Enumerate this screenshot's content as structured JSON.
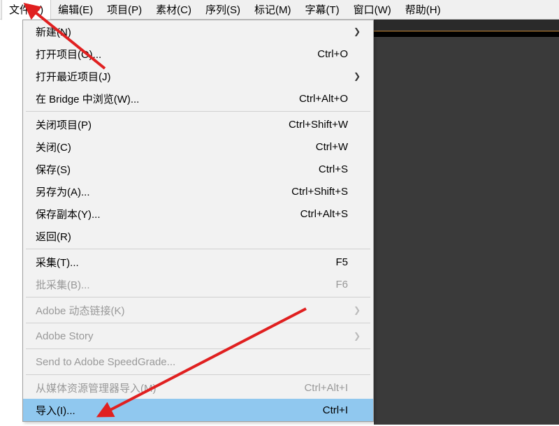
{
  "menubar": {
    "items": [
      {
        "label": "文件(F)"
      },
      {
        "label": "编辑(E)"
      },
      {
        "label": "项目(P)"
      },
      {
        "label": "素材(C)"
      },
      {
        "label": "序列(S)"
      },
      {
        "label": "标记(M)"
      },
      {
        "label": "字幕(T)"
      },
      {
        "label": "窗口(W)"
      },
      {
        "label": "帮助(H)"
      }
    ]
  },
  "dropdown": {
    "groups": [
      [
        {
          "label": "新建(N)",
          "shortcut": "",
          "arrow": true,
          "disabled": false
        },
        {
          "label": "打开项目(O)...",
          "shortcut": "Ctrl+O",
          "arrow": false,
          "disabled": false
        },
        {
          "label": "打开最近项目(J)",
          "shortcut": "",
          "arrow": true,
          "disabled": false
        },
        {
          "label": "在 Bridge 中浏览(W)...",
          "shortcut": "Ctrl+Alt+O",
          "arrow": false,
          "disabled": false
        }
      ],
      [
        {
          "label": "关闭项目(P)",
          "shortcut": "Ctrl+Shift+W",
          "arrow": false,
          "disabled": false
        },
        {
          "label": "关闭(C)",
          "shortcut": "Ctrl+W",
          "arrow": false,
          "disabled": false
        },
        {
          "label": "保存(S)",
          "shortcut": "Ctrl+S",
          "arrow": false,
          "disabled": false
        },
        {
          "label": "另存为(A)...",
          "shortcut": "Ctrl+Shift+S",
          "arrow": false,
          "disabled": false
        },
        {
          "label": "保存副本(Y)...",
          "shortcut": "Ctrl+Alt+S",
          "arrow": false,
          "disabled": false
        },
        {
          "label": "返回(R)",
          "shortcut": "",
          "arrow": false,
          "disabled": false
        }
      ],
      [
        {
          "label": "采集(T)...",
          "shortcut": "F5",
          "arrow": false,
          "disabled": false
        },
        {
          "label": "批采集(B)...",
          "shortcut": "F6",
          "arrow": false,
          "disabled": true
        }
      ],
      [
        {
          "label": "Adobe 动态链接(K)",
          "shortcut": "",
          "arrow": true,
          "disabled": true
        }
      ],
      [
        {
          "label": "Adobe Story",
          "shortcut": "",
          "arrow": true,
          "disabled": true
        }
      ],
      [
        {
          "label": "Send to Adobe SpeedGrade...",
          "shortcut": "",
          "arrow": false,
          "disabled": true
        }
      ],
      [
        {
          "label": "从媒体资源管理器导入(M)",
          "shortcut": "Ctrl+Alt+I",
          "arrow": false,
          "disabled": true
        },
        {
          "label": "导入(I)...",
          "shortcut": "Ctrl+I",
          "arrow": false,
          "disabled": false,
          "highlighted": true
        }
      ]
    ]
  },
  "arrow_chevron": "❯"
}
